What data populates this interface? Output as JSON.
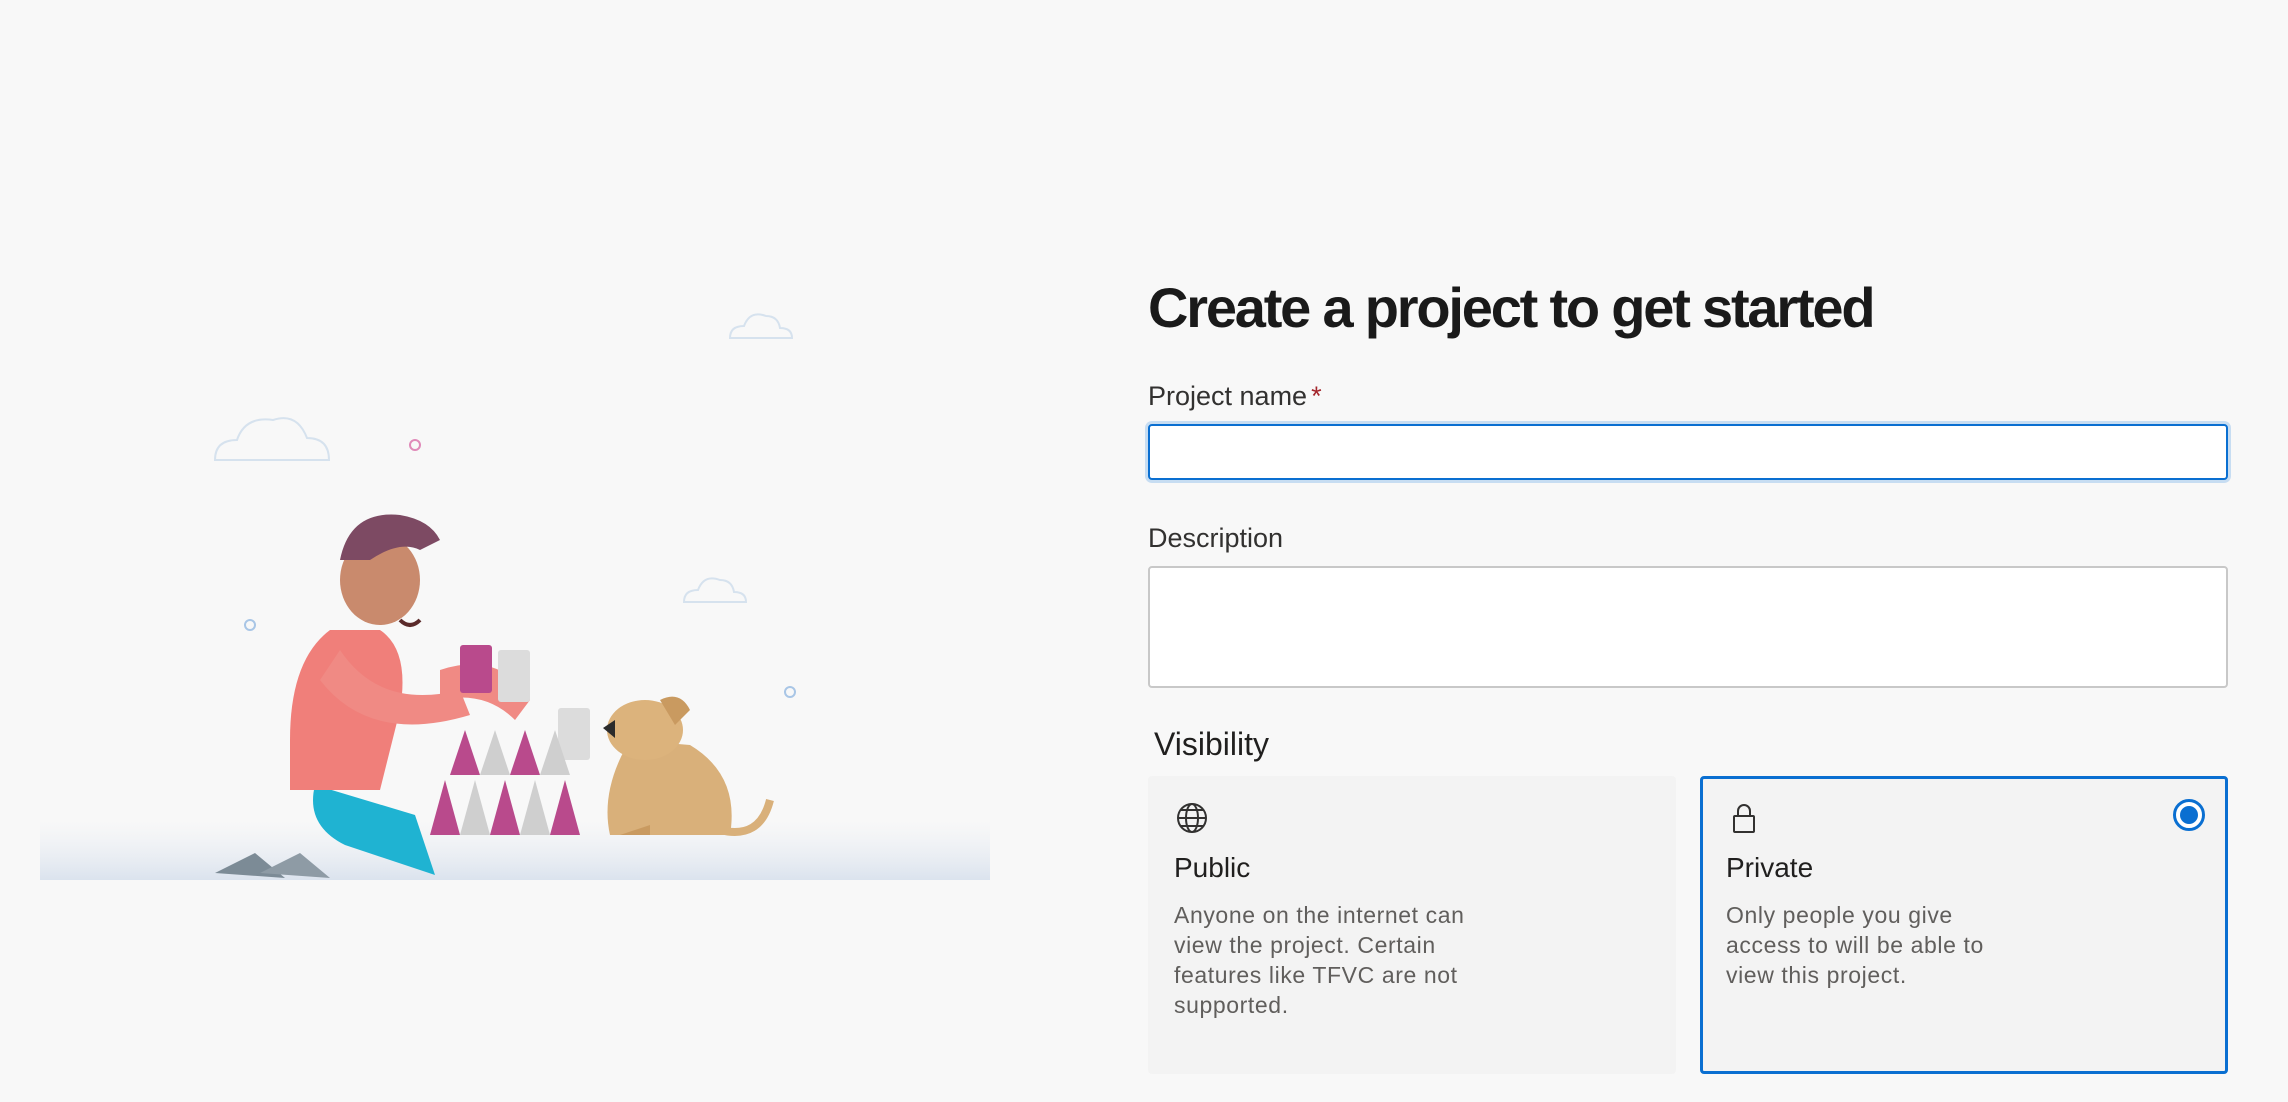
{
  "form": {
    "title": "Create a project to get started",
    "project_name_label": "Project name",
    "required_marker": "*",
    "project_name_value": "",
    "description_label": "Description",
    "description_value": "",
    "visibility_label": "Visibility",
    "options": [
      {
        "title": "Public",
        "icon": "globe-icon",
        "description": "Anyone on the internet can view the project. Certain features like TFVC are not supported.",
        "selected": false
      },
      {
        "title": "Private",
        "icon": "lock-icon",
        "description": "Only people you give access to will be able to view this project.",
        "selected": true
      }
    ]
  },
  "colors": {
    "accent": "#0a6fd1",
    "required": "#a4262c",
    "background": "#f8f8f8"
  }
}
